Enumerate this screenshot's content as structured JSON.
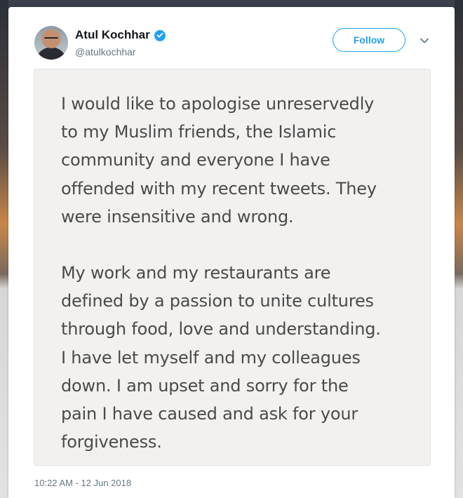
{
  "tweet": {
    "author": {
      "display_name": "Atul Kochhar",
      "handle": "@atulkochhar",
      "verified": true
    },
    "follow_label": "Follow",
    "statement_paragraphs": [
      "I would like to apologise unreservedly\nto my Muslim friends, the Islamic\ncommunity and everyone I have\noffended with my recent tweets. They\nwere insensitive and wrong.",
      "My work and my restaurants are\ndefined by a passion to unite cultures\nthrough food, love and understanding.\nI have let myself and my colleagues\ndown. I am upset and sorry for the\npain I have caused and ask for your\nforgiveness."
    ],
    "timestamp": "10:22 AM - 12 Jun 2018"
  },
  "icons": {
    "verified": "verified-badge-icon",
    "menu": "chevron-down-icon"
  },
  "colors": {
    "accent": "#1da1f2",
    "name_text": "#14171a",
    "secondary_text": "#657786",
    "statement_bg": "#f2f1ef",
    "statement_text": "#4a4a4a"
  }
}
